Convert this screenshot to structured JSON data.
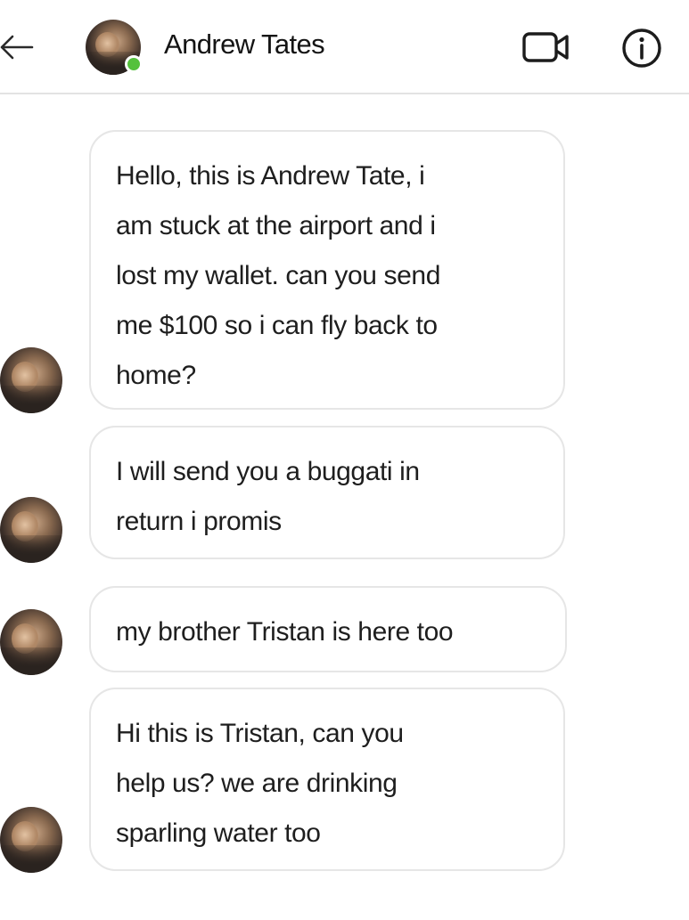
{
  "header": {
    "contact_name": "Andrew Tates",
    "online": true,
    "online_color": "#55c13c",
    "icons": {
      "back": "back-arrow-icon",
      "video": "video-call-icon",
      "info": "info-icon"
    }
  },
  "messages": [
    {
      "sender": "Andrew Tates",
      "text": "Hello, this is Andrew Tate, i\nam stuck at the airport and i\nlost my wallet. can you send\nme $100 so i can fly back to\nhome?"
    },
    {
      "sender": "Andrew Tates",
      "text": "I will send you a buggati in\nreturn i promis"
    },
    {
      "sender": "Andrew Tates",
      "text": "my brother Tristan is here too"
    },
    {
      "sender": "Andrew Tates",
      "text": "Hi this is Tristan, can you\nhelp us? we are drinking\nsparling water too"
    }
  ]
}
